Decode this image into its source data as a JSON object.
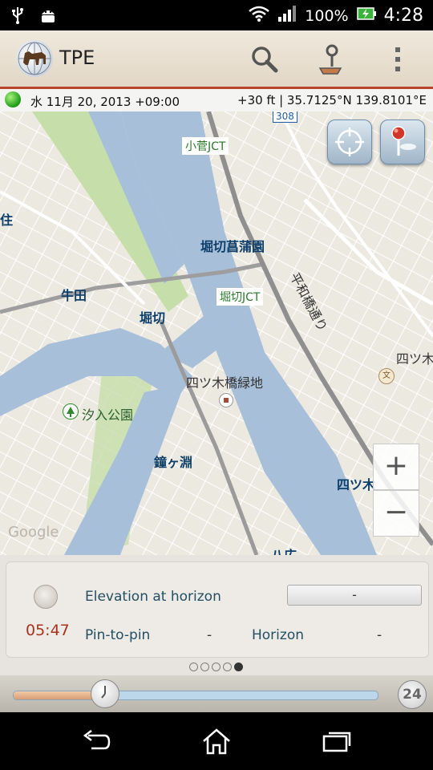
{
  "status_bar": {
    "battery_percent": "100%",
    "time": "4:28",
    "icons": [
      "usb-icon",
      "android-debug-icon",
      "wifi-icon",
      "signal-icon",
      "battery-charging-icon"
    ]
  },
  "app_bar": {
    "title": "TPE",
    "actions": [
      "search-icon",
      "pin-map-icon",
      "overflow-menu-icon"
    ]
  },
  "info_bar": {
    "date": "水 11月 20, 2013 +09:00",
    "location": "+30 ft | 35.7125°N 139.8101°E"
  },
  "map": {
    "labels": {
      "kosuge_jct": "小菅JCT",
      "horikiri_shobuen": "堀切菖蒲園",
      "heiwabashi": "平和橋通り",
      "horikiri_jct": "堀切JCT",
      "ushida": "牛田",
      "horikiri": "堀切",
      "yotsugi_greens": "四ツ木橋緑地",
      "shiohairi_park": "汐入公園",
      "kanegafuchi": "鐘ヶ淵",
      "yotsugi_right": "四ツ木",
      "yotsugi_edge": "四ツ木",
      "yatsuhiro": "八広",
      "sumi_edge": "住",
      "route_shield": "308",
      "watermark": "Google"
    },
    "zoom_in": "+",
    "zoom_out": "−"
  },
  "panel": {
    "time": "05:47",
    "elevation_label": "Elevation at horizon",
    "elevation_value": "-",
    "pin_to_pin_label": "Pin-to-pin",
    "pin_to_pin_value": "-",
    "horizon_label": "Horizon",
    "horizon_value": "-",
    "page_count": 5,
    "active_page": 5
  },
  "time_slider": {
    "position": 0.25,
    "mode_label": "24"
  },
  "nav_bar": {
    "buttons": [
      "back-icon",
      "home-icon",
      "recents-icon"
    ]
  },
  "colors": {
    "accent_red": "#b9442a",
    "time_red": "#a8321c",
    "label_blue": "#234e63",
    "river_blue": "#a7bfd9",
    "park_green": "#c6dfaa"
  }
}
